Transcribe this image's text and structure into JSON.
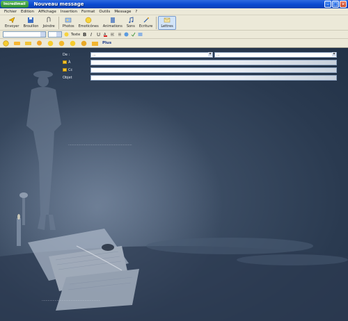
{
  "titlebar": {
    "start_label": "Incredimail",
    "title": "Nouveau message",
    "minimize": "–",
    "maximize": "□",
    "close": "×"
  },
  "menu": {
    "items": [
      "Fichier",
      "Edition",
      "Affichage",
      "Insertion",
      "Format",
      "Outils",
      "Message",
      "?"
    ]
  },
  "toolbar": {
    "buttons": [
      {
        "label": "Envoyer"
      },
      {
        "label": "Brouillon"
      },
      {
        "label": "Joindre"
      },
      {
        "label": "Photos"
      },
      {
        "label": "Emoticônes"
      },
      {
        "label": "Animations"
      },
      {
        "label": "Sons"
      },
      {
        "label": "Ecriture"
      },
      {
        "label": "Lettres"
      }
    ]
  },
  "formatbar": {
    "font_value": "",
    "size_value": "",
    "text_label": "Texte"
  },
  "quickbar": {
    "plus_label": "Plus"
  },
  "header": {
    "from_label": "De :",
    "from_value": "...",
    "account_value": "...",
    "to_label": "À",
    "cc_label": "Cc",
    "subject_label": "Objet"
  },
  "body": {
    "line1": "................................................................",
    "line2": "..........................................................."
  },
  "colors": {
    "titlebar": "#0a4ad0",
    "chrome": "#ece9d8",
    "background": "#2a3a50"
  }
}
